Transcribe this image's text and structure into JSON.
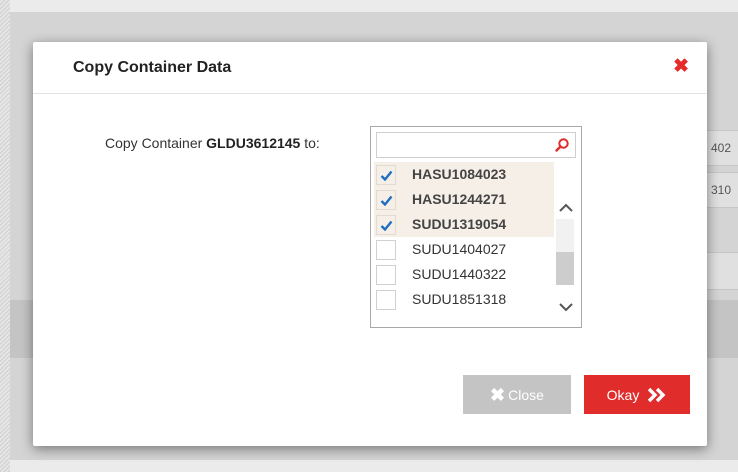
{
  "background": {
    "cells": [
      "402",
      "310",
      ""
    ]
  },
  "dialog": {
    "title": "Copy Container Data",
    "close_icon": "close-x-icon",
    "prompt_prefix": "Copy Container ",
    "container_id": "GLDU3612145",
    "prompt_suffix": " to:"
  },
  "picker": {
    "search_value": "",
    "items": [
      {
        "label": "HASU1084023",
        "checked": true
      },
      {
        "label": "HASU1244271",
        "checked": true
      },
      {
        "label": "SUDU1319054",
        "checked": true
      },
      {
        "label": "SUDU1404027",
        "checked": false
      },
      {
        "label": "SUDU1440322",
        "checked": false
      },
      {
        "label": "SUDU1851318",
        "checked": false
      }
    ]
  },
  "buttons": {
    "close_label": "Close",
    "okay_label": "Okay"
  },
  "colors": {
    "accent": "#e12c2c",
    "disabled": "#c4c4c4",
    "check": "#1f6fc1"
  }
}
